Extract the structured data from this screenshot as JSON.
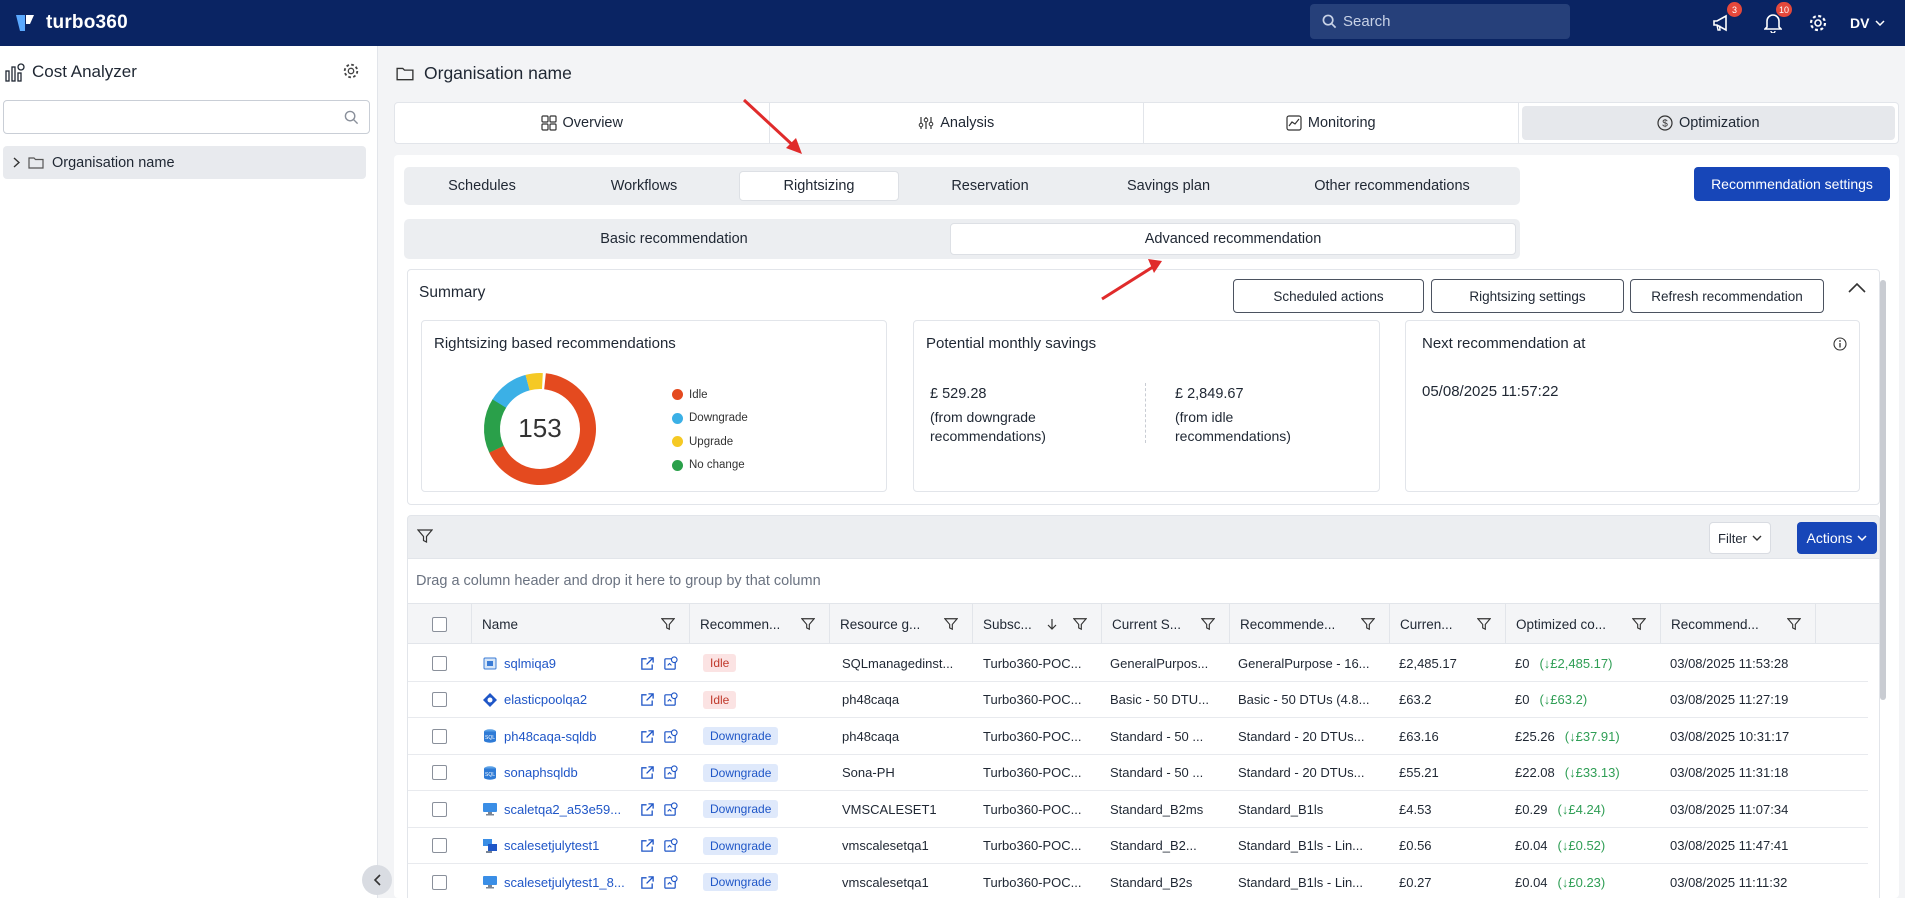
{
  "app": {
    "name": "turbo360"
  },
  "topbar": {
    "search_placeholder": "Search",
    "announcements_badge": "3",
    "notifications_badge": "10",
    "user_initials": "DV"
  },
  "sidebar": {
    "title": "Cost Analyzer",
    "search_value": "",
    "tree_item": "Organisation name"
  },
  "main": {
    "title": "Organisation name",
    "tabs": [
      {
        "label": "Overview"
      },
      {
        "label": "Analysis"
      },
      {
        "label": "Monitoring"
      },
      {
        "label": "Optimization"
      }
    ],
    "sub_tabs": [
      {
        "label": "Schedules"
      },
      {
        "label": "Workflows"
      },
      {
        "label": "Rightsizing"
      },
      {
        "label": "Reservation"
      },
      {
        "label": "Savings plan"
      },
      {
        "label": "Other recommendations"
      }
    ],
    "recommendation_settings": "Recommendation settings",
    "modes": [
      {
        "label": "Basic recommendation"
      },
      {
        "label": "Advanced recommendation"
      }
    ]
  },
  "summary": {
    "title": "Summary",
    "buttons": {
      "scheduled": "Scheduled actions",
      "rightsizing": "Rightsizing settings",
      "refresh": "Refresh recommendation"
    },
    "recs_card": {
      "title": "Rightsizing based recommendations",
      "total": "153",
      "legend": [
        {
          "label": "Idle",
          "color": "#e44a1f"
        },
        {
          "label": "Downgrade",
          "color": "#3bb0e6"
        },
        {
          "label": "Upgrade",
          "color": "#f5c924"
        },
        {
          "label": "No change",
          "color": "#2aa04a"
        }
      ]
    },
    "savings_card": {
      "title": "Potential monthly savings",
      "downgrade_amount": "£ 529.28",
      "downgrade_note_1": "(from downgrade",
      "downgrade_note_2": "recommendations)",
      "idle_amount": "£ 2,849.67",
      "idle_note_1": "(from idle",
      "idle_note_2": "recommendations)"
    },
    "next_card": {
      "title": "Next recommendation at",
      "date": "05/08/2025 11:57:22"
    }
  },
  "toolbar": {
    "filter": "Filter",
    "actions": "Actions"
  },
  "grid": {
    "group_hint": "Drag a column header and drop it here to group by that column",
    "columns": [
      "Name",
      "Recommen...",
      "Resource g...",
      "Subsc...",
      "Current S...",
      "Recommende...",
      "Curren...",
      "Optimized co...",
      "Recommend..."
    ],
    "rows": [
      {
        "name": "sqlmiqa9",
        "rec": "Idle",
        "rg": "SQLmanagedinst...",
        "sub": "Turbo360-POC...",
        "cur_sku": "GeneralPurpos...",
        "rec_sku": "GeneralPurpose - 16...",
        "cost": "£2,485.17",
        "opt": "£0",
        "saving": "(↓£2,485.17)",
        "date": "03/08/2025 11:53:28",
        "icon": "sql-mi"
      },
      {
        "name": "elasticpoolqa2",
        "rec": "Idle",
        "rg": "ph48caqa",
        "sub": "Turbo360-POC...",
        "cur_sku": "Basic - 50 DTU...",
        "rec_sku": "Basic - 50 DTUs (4.8...",
        "cost": "£63.2",
        "opt": "£0",
        "saving": "(↓£63.2)",
        "date": "03/08/2025 11:27:19",
        "icon": "elastic-pool"
      },
      {
        "name": "ph48caqa-sqldb",
        "rec": "Downgrade",
        "rg": "ph48caqa",
        "sub": "Turbo360-POC...",
        "cur_sku": "Standard - 50 ...",
        "rec_sku": "Standard - 20 DTUs...",
        "cost": "£63.16",
        "opt": "£25.26",
        "saving": "(↓£37.91)",
        "date": "03/08/2025 10:31:17",
        "icon": "sql-db"
      },
      {
        "name": "sonaphsqldb",
        "rec": "Downgrade",
        "rg": "Sona-PH",
        "sub": "Turbo360-POC...",
        "cur_sku": "Standard - 50 ...",
        "rec_sku": "Standard - 20 DTUs...",
        "cost": "£55.21",
        "opt": "£22.08",
        "saving": "(↓£33.13)",
        "date": "03/08/2025 11:31:18",
        "icon": "sql-db"
      },
      {
        "name": "scaletqa2_a53e59...",
        "rec": "Downgrade",
        "rg": "VMSCALESET1",
        "sub": "Turbo360-POC...",
        "cur_sku": "Standard_B2ms",
        "rec_sku": "Standard_B1ls",
        "cost": "£4.53",
        "opt": "£0.29",
        "saving": "(↓£4.24)",
        "date": "03/08/2025 11:07:34",
        "icon": "vm"
      },
      {
        "name": "scalesetjulytest1",
        "rec": "Downgrade",
        "rg": "vmscalesetqa1",
        "sub": "Turbo360-POC...",
        "cur_sku": "Standard_B2...",
        "rec_sku": "Standard_B1ls - Lin...",
        "cost": "£0.56",
        "opt": "£0.04",
        "saving": "(↓£0.52)",
        "date": "03/08/2025 11:47:41",
        "icon": "vmss"
      },
      {
        "name": "scalesetjulytest1_8...",
        "rec": "Downgrade",
        "rg": "vmscalesetqa1",
        "sub": "Turbo360-POC...",
        "cur_sku": "Standard_B2s",
        "rec_sku": "Standard_B1ls - Lin...",
        "cost": "£0.27",
        "opt": "£0.04",
        "saving": "(↓£0.23)",
        "date": "03/08/2025 11:11:32",
        "icon": "vm"
      }
    ]
  }
}
